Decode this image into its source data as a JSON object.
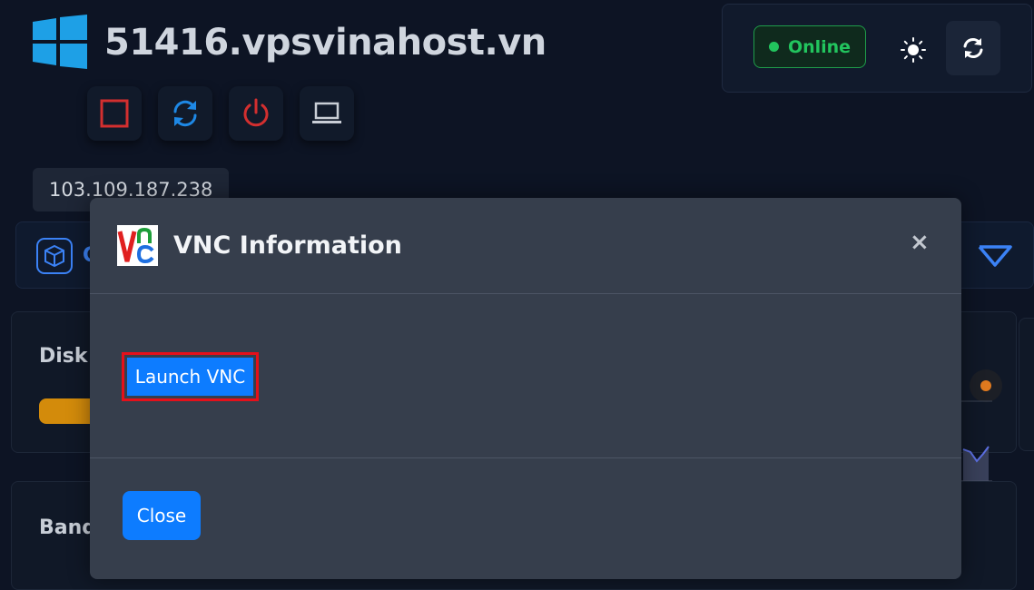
{
  "header": {
    "hostname": "51416.vpsvinahost.vn",
    "status": "Online",
    "ip_address": "103.109.187.238"
  },
  "os_row": {
    "text_partial": "C"
  },
  "cards": {
    "disk_label": "Disk U",
    "bandwidth_label": "Band"
  },
  "modal": {
    "title": "VNC Information",
    "close_icon": "×",
    "launch_button": "Launch VNC",
    "close_button": "Close"
  },
  "colors": {
    "accent_blue": "#0d7cff",
    "online_green": "#22c55e",
    "highlight_red": "#e5101a",
    "disk_bar": "#d38b0b"
  }
}
